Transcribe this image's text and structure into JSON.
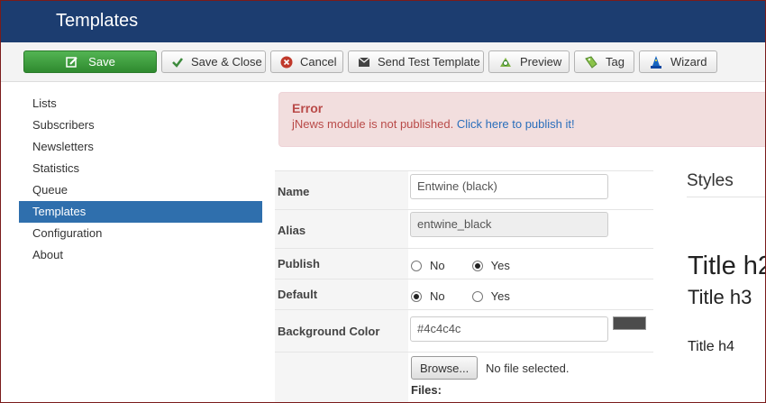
{
  "header": {
    "title": "Templates"
  },
  "toolbar": {
    "save": "Save",
    "save_close": "Save & Close",
    "cancel": "Cancel",
    "send_test": "Send Test Template",
    "preview": "Preview",
    "tag": "Tag",
    "wizard": "Wizard"
  },
  "sidebar": {
    "items": [
      {
        "label": "Lists"
      },
      {
        "label": "Subscribers"
      },
      {
        "label": "Newsletters"
      },
      {
        "label": "Statistics"
      },
      {
        "label": "Queue"
      },
      {
        "label": "Templates",
        "active": true
      },
      {
        "label": "Configuration"
      },
      {
        "label": "About"
      }
    ]
  },
  "alert": {
    "heading": "Error",
    "message": "jNews module is not published. ",
    "link": "Click here to publish it!"
  },
  "form": {
    "name": {
      "label": "Name",
      "value": "Entwine (black)"
    },
    "alias": {
      "label": "Alias",
      "value": "entwine_black"
    },
    "publish": {
      "label": "Publish",
      "options": [
        "No",
        "Yes"
      ],
      "selected": "Yes"
    },
    "default": {
      "label": "Default",
      "options": [
        "No",
        "Yes"
      ],
      "selected": "No"
    },
    "background": {
      "label": "Background Color",
      "value": "#4c4c4c"
    },
    "files": {
      "browse": "Browse...",
      "status": "No file selected.",
      "label": "Files:"
    }
  },
  "styles": {
    "title": "Styles",
    "h2": "Title h2",
    "h3": "Title h3",
    "h4": "Title h4"
  },
  "colors": {
    "header_bg": "#1c3d70",
    "save_green": "#3c9a3c",
    "active_blue": "#2f6fad",
    "error_bg": "#f2dede",
    "error_text": "#b94a48",
    "link": "#2a6ebb"
  },
  "icons": {
    "save": "edit-icon",
    "save_close": "check-icon",
    "cancel": "cancel-icon",
    "send_test": "envelope-icon",
    "preview": "preview-icon",
    "tag": "tag-icon",
    "wizard": "wizard-icon"
  }
}
